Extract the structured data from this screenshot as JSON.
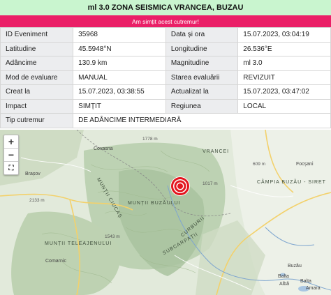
{
  "header": {
    "title": "ml 3.0 ZONA SEISMICA VRANCEA, BUZAU"
  },
  "felt_bar": {
    "label": "Am simțit acest cutremur!"
  },
  "info": {
    "id_label": "ID Eveniment",
    "id_value": "35968",
    "date_label": "Data și ora",
    "date_value": "15.07.2023, 03:04:19",
    "lat_label": "Latitudine",
    "lat_value": "45.5948°N",
    "lon_label": "Longitudine",
    "lon_value": "26.536°E",
    "depth_label": "Adâncime",
    "depth_value": "130.9 km",
    "mag_label": "Magnitudine",
    "mag_value": "ml 3.0",
    "mode_label": "Mod de evaluare",
    "mode_value": "MANUAL",
    "status_label": "Starea evaluării",
    "status_value": "REVIZUIT",
    "created_label": "Creat la",
    "created_value": "15.07.2023, 03:38:55",
    "updated_label": "Actualizat la",
    "updated_value": "15.07.2023, 03:47:02",
    "impact_label": "Impact",
    "impact_value": "SIMȚIT",
    "region_label": "Regiunea",
    "region_value": "LOCAL",
    "type_label": "Tip cutremur",
    "type_value": "DE ADÂNCIME INTERMEDIARĂ"
  },
  "map": {
    "zoom_in": "+",
    "zoom_out": "−",
    "fullscreen": "⛶",
    "labels": {
      "covasna": "Covasna",
      "brasov": "Brașov",
      "focsani": "Focșani",
      "muntii_buzaului": "MUNȚII BUZĂULUI",
      "campia": "CÂMPIA BUZĂU - SIRET",
      "ciucas": "MUNȚII CIUCAȘ",
      "teleajen": "MUNȚII TELEAJENULUI",
      "comarnic": "Comarnic",
      "buzau": "Buzău",
      "balta": "Balta",
      "balta2": "Balta",
      "alba": "Albă",
      "amara": "Amara",
      "subcarpati": "SUBCARPAȚII",
      "peak1": "1778 m",
      "peak2": "2133 m",
      "peak3": "609 m",
      "peak4": "1017 m",
      "peak5": "1543 m",
      "vrancea": "VRANCEI",
      "curbura": "CURBURII"
    },
    "epicenter_color": "#e3161f"
  }
}
